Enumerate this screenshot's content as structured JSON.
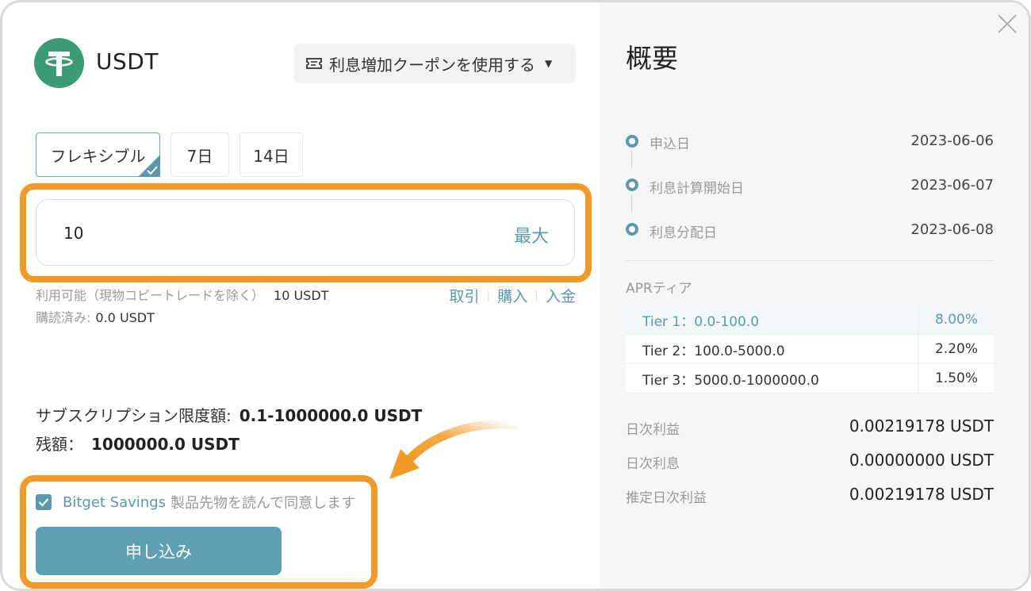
{
  "coin": {
    "name": "USDT"
  },
  "coupon": {
    "label": "利息増加クーポンを使用する"
  },
  "tabs": [
    {
      "label": "フレキシブル",
      "active": true
    },
    {
      "label": "7日",
      "active": false
    },
    {
      "label": "14日",
      "active": false
    }
  ],
  "amount": {
    "value": "10",
    "max_label": "最大"
  },
  "available": {
    "label": "利用可能（現物コピートレードを除く）",
    "value": "10 USDT"
  },
  "subscribed": {
    "label": "購読済み:",
    "value": "0.0 USDT"
  },
  "links": {
    "transfer": "取引",
    "buy": "購入",
    "deposit": "入金"
  },
  "limit": {
    "label": "サブスクリプション限度額:",
    "value": "0.1-1000000.0 USDT"
  },
  "balance": {
    "label": "残額：",
    "value": "1000000.0 USDT"
  },
  "agreement": {
    "checked": true,
    "link_text": "Bitget Savings",
    "text": "製品先物を読んで同意します"
  },
  "submit": {
    "label": "申し込み"
  },
  "summary": {
    "title": "概要",
    "timeline": [
      {
        "label": "申込日",
        "date": "2023-06-06"
      },
      {
        "label": "利息計算開始日",
        "date": "2023-06-07"
      },
      {
        "label": "利息分配日",
        "date": "2023-06-08"
      }
    ],
    "apr_label": "APRティア",
    "tiers": [
      {
        "name": "Tier 1：0.0-100.0",
        "rate": "8.00%",
        "highlight": true
      },
      {
        "name": "Tier 2：100.0-5000.0",
        "rate": "2.20%",
        "highlight": false
      },
      {
        "name": "Tier 3：5000.0-1000000.0",
        "rate": "1.50%",
        "highlight": false
      }
    ],
    "stats": [
      {
        "label": "日次利益",
        "value": "0.00219178 USDT"
      },
      {
        "label": "日次利息",
        "value": "0.00000000 USDT"
      },
      {
        "label": "推定日次利益",
        "value": "0.00219178 USDT"
      }
    ]
  },
  "colors": {
    "accent": "#5b98ad",
    "highlight_orange": "#f39a26",
    "tether_green": "#3a9b74"
  },
  "icons": [
    "tether-logo-icon",
    "coupon-tag-icon",
    "caret-down-icon",
    "check-corner-icon",
    "checkbox-check-icon",
    "close-icon",
    "curved-arrow-icon",
    "timeline-dot-icon"
  ]
}
